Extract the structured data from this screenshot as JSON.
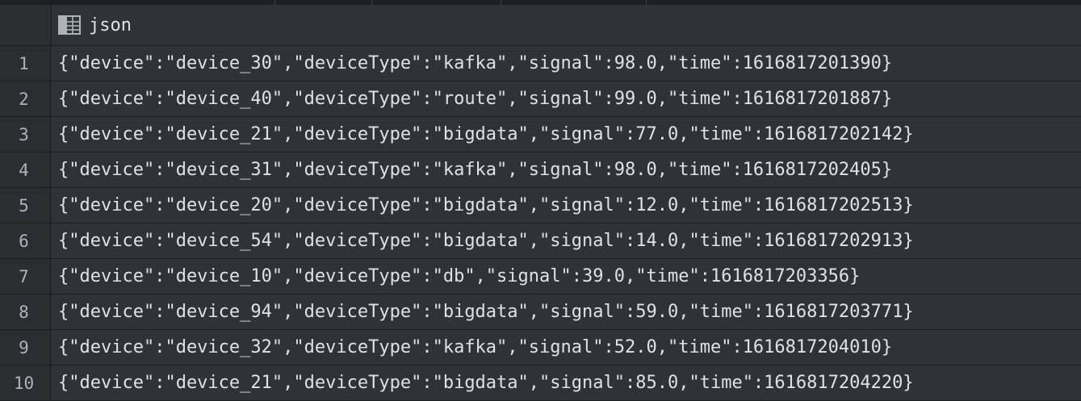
{
  "column": {
    "name": "json",
    "icon": "table-column-icon"
  },
  "rows": [
    {
      "num": "1",
      "value": "{\"device\":\"device_30\",\"deviceType\":\"kafka\",\"signal\":98.0,\"time\":1616817201390}"
    },
    {
      "num": "2",
      "value": "{\"device\":\"device_40\",\"deviceType\":\"route\",\"signal\":99.0,\"time\":1616817201887}"
    },
    {
      "num": "3",
      "value": "{\"device\":\"device_21\",\"deviceType\":\"bigdata\",\"signal\":77.0,\"time\":1616817202142}"
    },
    {
      "num": "4",
      "value": "{\"device\":\"device_31\",\"deviceType\":\"kafka\",\"signal\":98.0,\"time\":1616817202405}"
    },
    {
      "num": "5",
      "value": "{\"device\":\"device_20\",\"deviceType\":\"bigdata\",\"signal\":12.0,\"time\":1616817202513}"
    },
    {
      "num": "6",
      "value": "{\"device\":\"device_54\",\"deviceType\":\"bigdata\",\"signal\":14.0,\"time\":1616817202913}"
    },
    {
      "num": "7",
      "value": "{\"device\":\"device_10\",\"deviceType\":\"db\",\"signal\":39.0,\"time\":1616817203356}"
    },
    {
      "num": "8",
      "value": "{\"device\":\"device_94\",\"deviceType\":\"bigdata\",\"signal\":59.0,\"time\":1616817203771}"
    },
    {
      "num": "9",
      "value": "{\"device\":\"device_32\",\"deviceType\":\"kafka\",\"signal\":52.0,\"time\":1616817204010}"
    },
    {
      "num": "10",
      "value": "{\"device\":\"device_21\",\"deviceType\":\"bigdata\",\"signal\":85.0,\"time\":1616817204220}"
    }
  ]
}
